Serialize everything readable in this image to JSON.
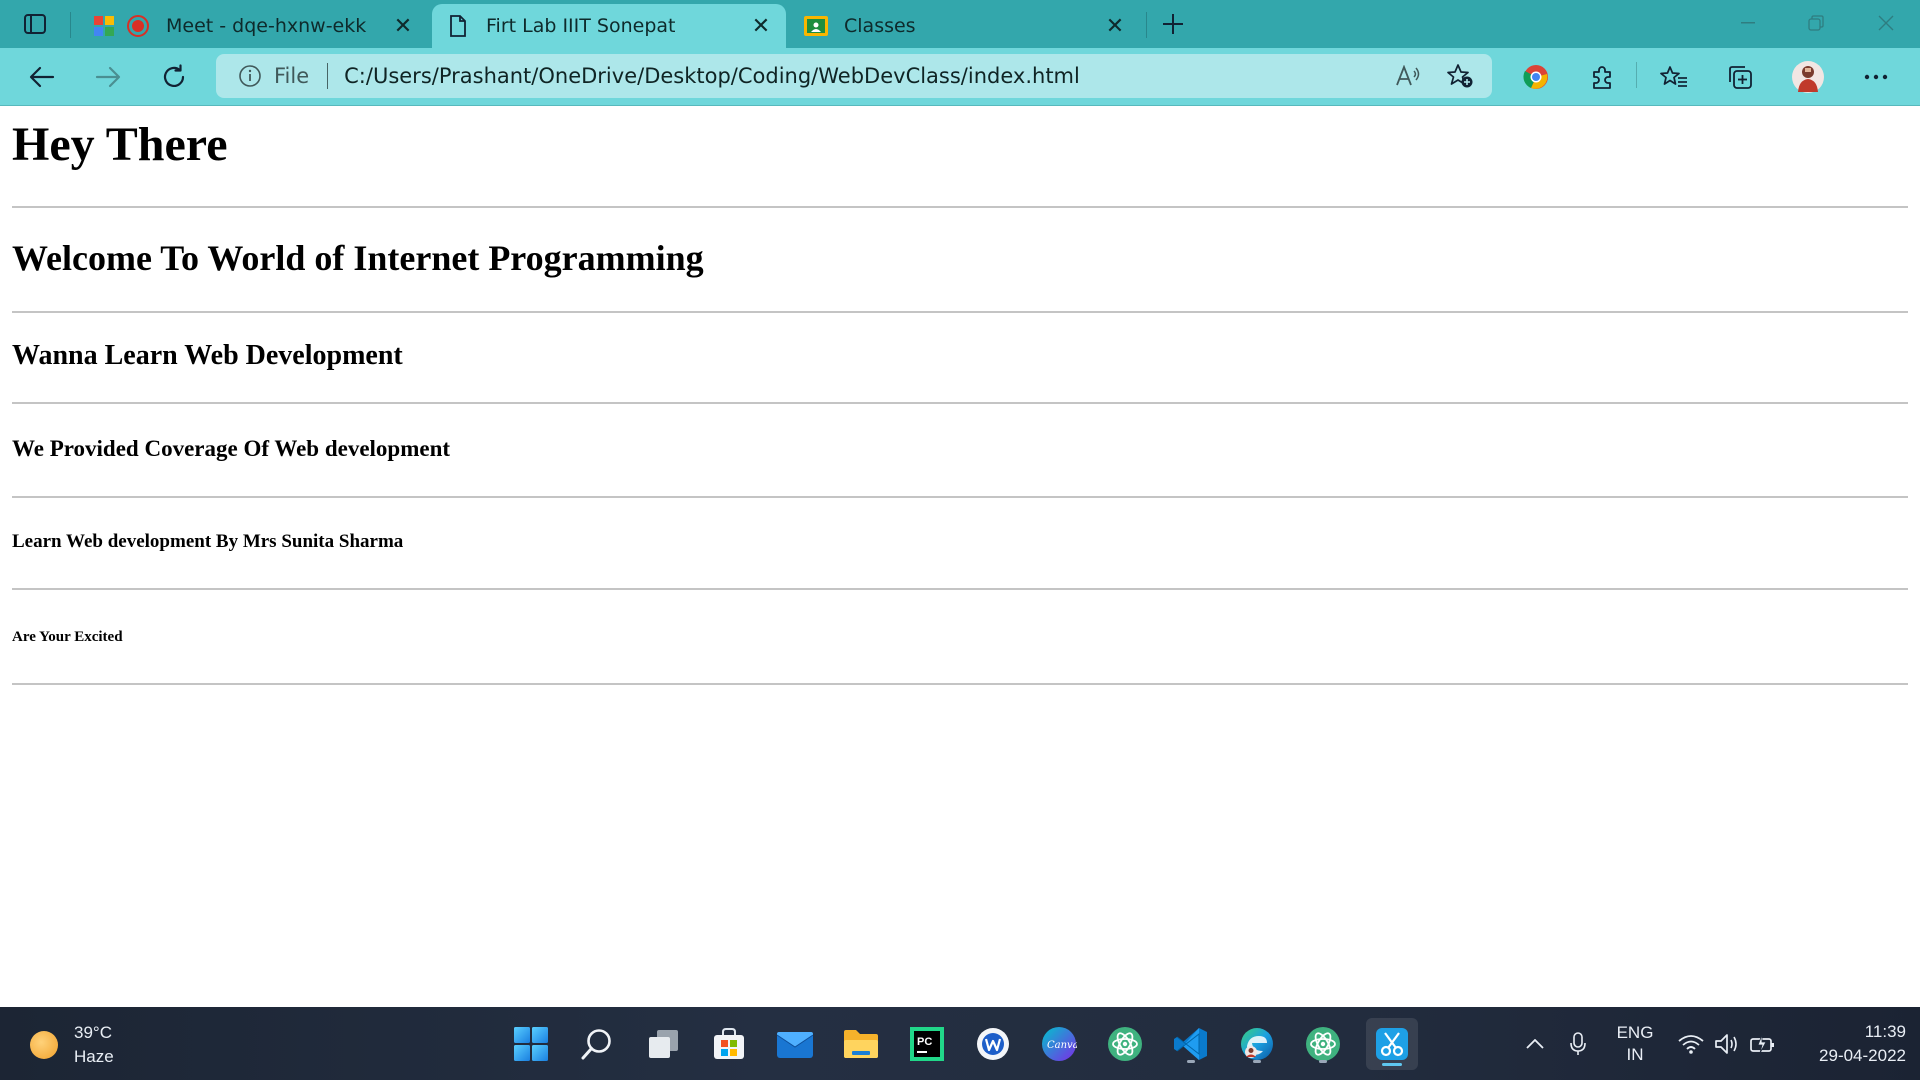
{
  "browser": {
    "tabs": [
      {
        "title": "Meet - dqe-hxnw-ekk",
        "favicon": "meet-icon",
        "active": false
      },
      {
        "title": "Firt Lab IIIT Sonepat",
        "favicon": "file-icon",
        "active": true
      },
      {
        "title": "Classes",
        "favicon": "classroom-icon",
        "active": false
      }
    ],
    "address": {
      "scheme": "File",
      "url": "C:/Users/Prashant/OneDrive/Desktop/Coding/WebDevClass/index.html"
    },
    "colors": {
      "tabstrip": "#33a7ac",
      "toolbar": "#6fd7db",
      "omnibox": "#ade7ea"
    }
  },
  "page": {
    "h1": "Hey There",
    "h2": "Welcome To World of Internet Programming",
    "h3": "Wanna Learn Web Development",
    "h4": "We Provided Coverage Of Web development",
    "h5": "Learn Web development By Mrs Sunita Sharma",
    "h6": "Are Your Excited"
  },
  "taskbar": {
    "weather": {
      "temp": "39°C",
      "condition": "Haze"
    },
    "apps": [
      "start-icon",
      "search-icon",
      "task-view-icon",
      "store-icon",
      "mail-icon",
      "file-explorer-icon",
      "pycharm-icon",
      "word-icon",
      "canva-icon",
      "atom-icon",
      "vscode-icon",
      "edge-icon",
      "atom-icon",
      "snipping-tool-icon"
    ],
    "tray": {
      "lang_top": "ENG",
      "lang_bottom": "IN",
      "time": "11:39",
      "date": "29-04-2022"
    }
  }
}
